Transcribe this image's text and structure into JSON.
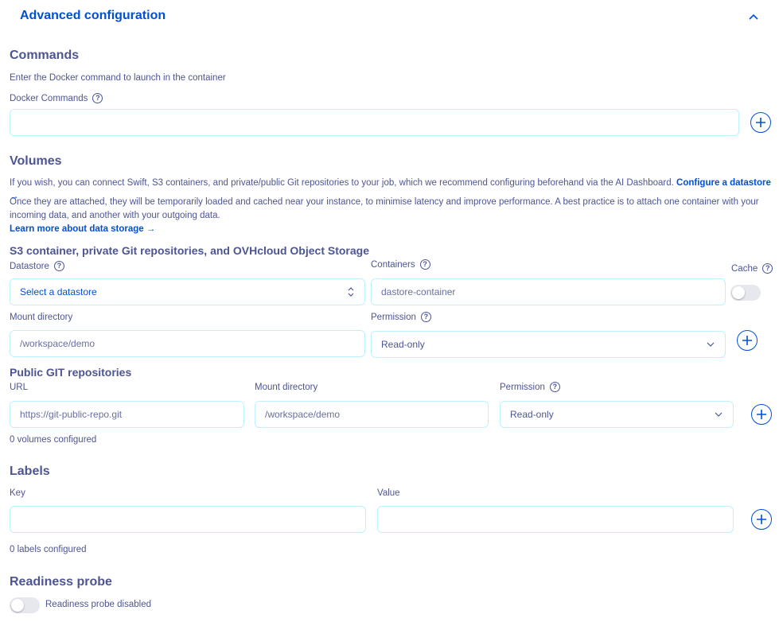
{
  "accordion": {
    "title": "Advanced configuration"
  },
  "commands": {
    "title": "Commands",
    "description": "Enter the Docker command to launch in the container",
    "docker_label": "Docker Commands",
    "docker_value": "",
    "docker_placeholder": ""
  },
  "volumes": {
    "title": "Volumes",
    "desc1": "If you wish, you can connect Swift, S3 containers, and private/public Git repositories to your job, which we recommend configuring beforehand via the AI Dashboard.",
    "configure_link": "Configure a datastore →",
    "desc2": "Once they are attached, they will be temporarily loaded and cached near your instance, to minimise latency and improve performance. A best practice is to attach one container with your incoming data, and another with your outgoing data.",
    "learn_link": "Learn more about data storage →",
    "s3": {
      "title": "S3 container, private Git repositories, and OVHcloud Object Storage",
      "datastore_label": "Datastore",
      "datastore_value": "Select a datastore",
      "containers_label": "Containers",
      "containers_placeholder": "dastore-container",
      "cache_label": "Cache",
      "mount_label": "Mount directory",
      "mount_placeholder": "/workspace/demo",
      "permission_label": "Permission",
      "permission_value": "Read-only"
    },
    "git": {
      "title": "Public GIT repositories",
      "url_label": "URL",
      "url_placeholder": "https://git-public-repo.git",
      "mount_label": "Mount directory",
      "mount_placeholder": "/workspace/demo",
      "permission_label": "Permission",
      "permission_value": "Read-only"
    },
    "count": "0 volumes configured"
  },
  "labels": {
    "title": "Labels",
    "key_label": "Key",
    "value_label": "Value",
    "count": "0 labels configured"
  },
  "readiness": {
    "title": "Readiness probe",
    "toggle_label": "Readiness probe disabled"
  },
  "colors": {
    "primary": "#0050d7",
    "text": "#4d5592",
    "border": "#bef1ff"
  }
}
